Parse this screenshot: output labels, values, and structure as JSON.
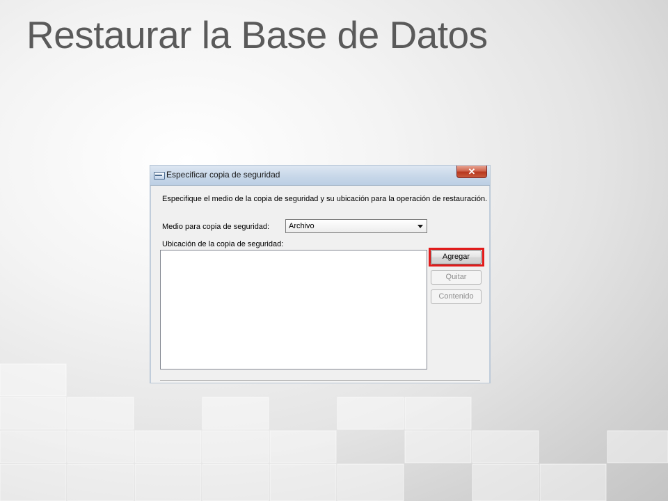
{
  "slide": {
    "title": "Restaurar la Base de Datos"
  },
  "dialog": {
    "title": "Especificar copia de seguridad",
    "close_icon": "close-icon",
    "description": "Especifique el medio de la copia de seguridad y su ubicación para la operación de restauración.",
    "media_label": "Medio para copia de seguridad:",
    "media_selected": "Archivo",
    "location_label": "Ubicación de la copia de seguridad:",
    "buttons": {
      "add": "Agregar",
      "remove": "Quitar",
      "contents": "Contenido"
    }
  },
  "colors": {
    "title_text": "#5a5a5a",
    "highlight": "#e21b1b",
    "dialog_background": "#f0f0f0"
  }
}
